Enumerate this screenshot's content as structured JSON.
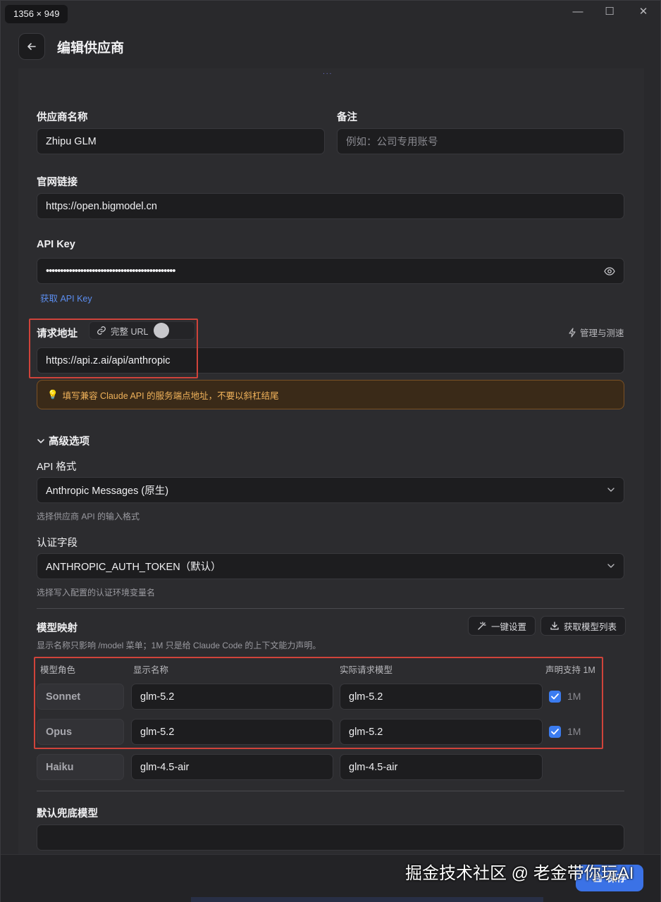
{
  "titlebar": {
    "dimensions_badge": "1356 × 949",
    "minimize_glyph": "—",
    "maximize_glyph": "☐",
    "close_glyph": "✕"
  },
  "header": {
    "title": "编辑供应商"
  },
  "form": {
    "provider_name": {
      "label": "供应商名称",
      "value": "Zhipu GLM"
    },
    "notes": {
      "label": "备注",
      "placeholder": "例如：公司专用账号"
    },
    "website": {
      "label": "官网链接",
      "value": "https://open.bigmodel.cn"
    },
    "api_key": {
      "label": "API Key",
      "value": "•••••••••••••••••••••••••••••••••••••••••••••",
      "get_key_link": "获取 API Key"
    },
    "request_url": {
      "label": "请求地址",
      "full_url_label": "完整 URL",
      "manage_label": "管理与测速",
      "value": "https://api.z.ai/api/anthropic",
      "warning": "填写兼容 Claude API 的服务端点地址，不要以斜杠结尾"
    },
    "advanced": {
      "label": "高级选项",
      "api_format": {
        "label": "API 格式",
        "value": "Anthropic Messages (原生)",
        "hint": "选择供应商 API 的输入格式"
      },
      "auth_field": {
        "label": "认证字段",
        "value": "ANTHROPIC_AUTH_TOKEN（默认）",
        "hint": "选择写入配置的认证环境变量名"
      }
    },
    "model_mapping": {
      "label": "模型映射",
      "hint": "显示名称只影响 /model 菜单；1M 只是给 Claude Code 的上下文能力声明。",
      "one_click_label": "一键设置",
      "fetch_models_label": "获取模型列表",
      "columns": [
        "模型角色",
        "显示名称",
        "实际请求模型",
        "声明支持 1M"
      ],
      "rows": [
        {
          "role": "Sonnet",
          "display": "glm-5.2",
          "actual": "glm-5.2",
          "flag": "1M"
        },
        {
          "role": "Opus",
          "display": "glm-5.2",
          "actual": "glm-5.2",
          "flag": "1M"
        },
        {
          "role": "Haiku",
          "display": "glm-4.5-air",
          "actual": "glm-4.5-air"
        }
      ]
    },
    "default_fallback": {
      "label": "默认兜底模型",
      "value": ""
    }
  },
  "footer": {
    "save_label": "保存",
    "watermark": "掘金技术社区 @ 老金带你玩AI"
  },
  "colors": {
    "accent": "#3b72e6",
    "warning_text": "#f0b25a",
    "highlight_box": "#d0433a"
  }
}
